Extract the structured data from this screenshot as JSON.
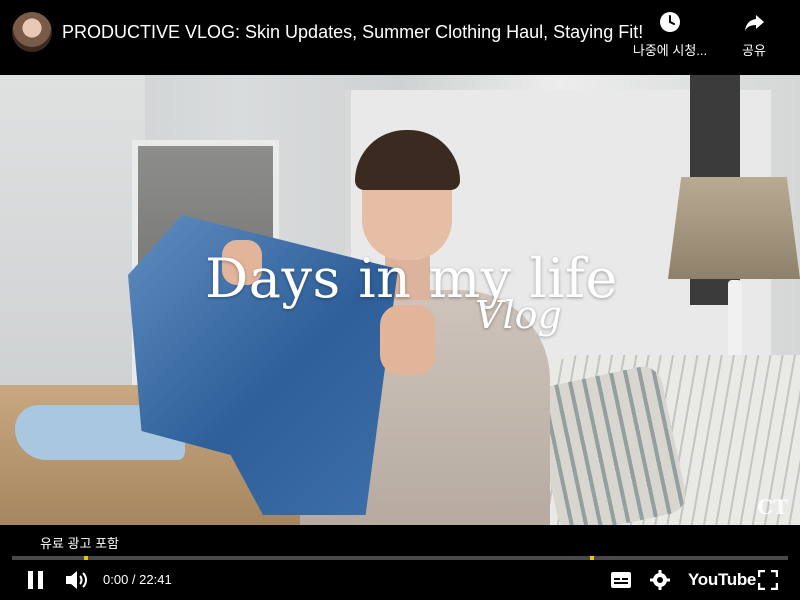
{
  "header": {
    "title": "PRODUCTIVE VLOG: Skin Updates, Summer Clothing Haul, Staying Fit!",
    "watch_later_label": "나중에 시청...",
    "share_label": "공유"
  },
  "video": {
    "overlay_title": "Days in my life",
    "overlay_subtitle": "Vlog",
    "watermark": "CT"
  },
  "player": {
    "paid_promotion_label": "유료 광고 포함",
    "time_display": "0:00 / 22:41",
    "logo_text": "YouTube",
    "icons": [
      "pause-icon",
      "volume-icon",
      "subtitles-icon",
      "settings-gear-icon",
      "fullscreen-icon",
      "clock-icon",
      "share-arrow-icon"
    ],
    "accent_color": "#f4c400"
  }
}
